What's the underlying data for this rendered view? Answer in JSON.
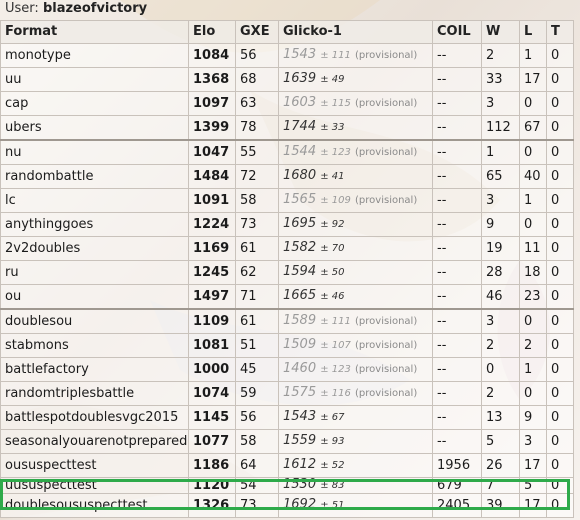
{
  "user": {
    "label": "User:",
    "name": "blazeofvictory"
  },
  "columns": [
    "Format",
    "Elo",
    "GXE",
    "Glicko-1",
    "COIL",
    "W",
    "L",
    "T"
  ],
  "rows": [
    {
      "format": "monotype",
      "elo": "1084",
      "gxe": "56",
      "glicko": "1543",
      "dev": "± 111",
      "prov": "(provisional)",
      "coil": "--",
      "w": "2",
      "l": "1",
      "t": "0"
    },
    {
      "format": "uu",
      "elo": "1368",
      "gxe": "68",
      "glicko": "1639",
      "dev": "± 49",
      "prov": "",
      "coil": "--",
      "w": "33",
      "l": "17",
      "t": "0"
    },
    {
      "format": "cap",
      "elo": "1097",
      "gxe": "63",
      "glicko": "1603",
      "dev": "± 115",
      "prov": "(provisional)",
      "coil": "--",
      "w": "3",
      "l": "0",
      "t": "0"
    },
    {
      "format": "ubers",
      "elo": "1399",
      "gxe": "78",
      "glicko": "1744",
      "dev": "± 33",
      "prov": "",
      "coil": "--",
      "w": "112",
      "l": "67",
      "t": "0"
    },
    {
      "format": "nu",
      "elo": "1047",
      "gxe": "55",
      "glicko": "1544",
      "dev": "± 123",
      "prov": "(provisional)",
      "coil": "--",
      "w": "1",
      "l": "0",
      "t": "0"
    },
    {
      "format": "randombattle",
      "elo": "1484",
      "gxe": "72",
      "glicko": "1680",
      "dev": "± 41",
      "prov": "",
      "coil": "--",
      "w": "65",
      "l": "40",
      "t": "0"
    },
    {
      "format": "lc",
      "elo": "1091",
      "gxe": "58",
      "glicko": "1565",
      "dev": "± 109",
      "prov": "(provisional)",
      "coil": "--",
      "w": "3",
      "l": "1",
      "t": "0"
    },
    {
      "format": "anythinggoes",
      "elo": "1224",
      "gxe": "73",
      "glicko": "1695",
      "dev": "± 92",
      "prov": "",
      "coil": "--",
      "w": "9",
      "l": "0",
      "t": "0"
    },
    {
      "format": "2v2doubles",
      "elo": "1169",
      "gxe": "61",
      "glicko": "1582",
      "dev": "± 70",
      "prov": "",
      "coil": "--",
      "w": "19",
      "l": "11",
      "t": "0"
    },
    {
      "format": "ru",
      "elo": "1245",
      "gxe": "62",
      "glicko": "1594",
      "dev": "± 50",
      "prov": "",
      "coil": "--",
      "w": "28",
      "l": "18",
      "t": "0"
    },
    {
      "format": "ou",
      "elo": "1497",
      "gxe": "71",
      "glicko": "1665",
      "dev": "± 46",
      "prov": "",
      "coil": "--",
      "w": "46",
      "l": "23",
      "t": "0"
    },
    {
      "format": "doublesou",
      "elo": "1109",
      "gxe": "61",
      "glicko": "1589",
      "dev": "± 111",
      "prov": "(provisional)",
      "coil": "--",
      "w": "3",
      "l": "0",
      "t": "0"
    },
    {
      "format": "stabmons",
      "elo": "1081",
      "gxe": "51",
      "glicko": "1509",
      "dev": "± 107",
      "prov": "(provisional)",
      "coil": "--",
      "w": "2",
      "l": "2",
      "t": "0"
    },
    {
      "format": "battlefactory",
      "elo": "1000",
      "gxe": "45",
      "glicko": "1460",
      "dev": "± 123",
      "prov": "(provisional)",
      "coil": "--",
      "w": "0",
      "l": "1",
      "t": "0"
    },
    {
      "format": "randomtriplesbattle",
      "elo": "1074",
      "gxe": "59",
      "glicko": "1575",
      "dev": "± 116",
      "prov": "(provisional)",
      "coil": "--",
      "w": "2",
      "l": "0",
      "t": "0"
    },
    {
      "format": "battlespotdoublesvgc2015",
      "elo": "1145",
      "gxe": "56",
      "glicko": "1543",
      "dev": "± 67",
      "prov": "",
      "coil": "--",
      "w": "13",
      "l": "9",
      "t": "0"
    },
    {
      "format": "seasonalyouarenotprepared",
      "elo": "1077",
      "gxe": "58",
      "glicko": "1559",
      "dev": "± 93",
      "prov": "",
      "coil": "--",
      "w": "5",
      "l": "3",
      "t": "0"
    },
    {
      "format": "oususpecttest",
      "elo": "1186",
      "gxe": "64",
      "glicko": "1612",
      "dev": "± 52",
      "prov": "",
      "coil": "1956",
      "w": "26",
      "l": "17",
      "t": "0"
    },
    {
      "format": "uususpecttest",
      "elo": "1120",
      "gxe": "54",
      "glicko": "1530",
      "dev": "± 83",
      "prov": "",
      "coil": "679",
      "w": "7",
      "l": "5",
      "t": "0"
    },
    {
      "format": "doublesoususpecttest",
      "elo": "1326",
      "gxe": "73",
      "glicko": "1692",
      "dev": "± 51",
      "prov": "",
      "coil": "2405",
      "w": "39",
      "l": "17",
      "t": "0"
    }
  ],
  "colors": {
    "highlight": "#2eaa4a",
    "border": "#c9c2bb"
  }
}
